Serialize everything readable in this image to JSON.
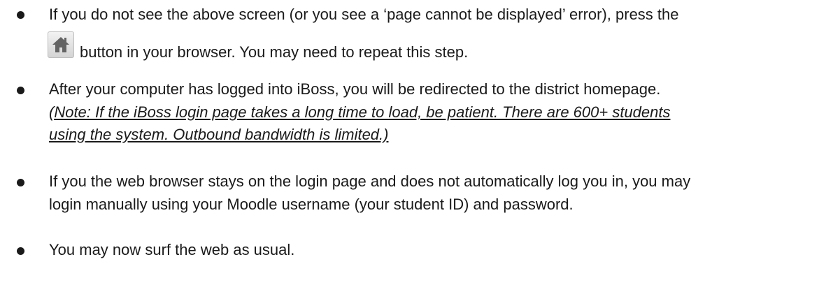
{
  "items": [
    {
      "line1": "If you do not see the above screen (or you see a ‘page cannot be displayed’ error), press the",
      "line2": "button in your browser.  You may need to repeat this step.",
      "icon": "home-icon"
    },
    {
      "line1": "After your computer has logged into iBoss, you will be redirected to the district homepage.",
      "note_line1": "(Note: If the iBoss login page takes a long time to load, be patient.  There are 600+ students",
      "note_line2": "using the system.  Outbound bandwidth is limited.)"
    },
    {
      "line1": "If you the web browser stays on the login page and does not automatically log you in, you may",
      "line2": "login manually using your Moodle username (your student ID) and password."
    },
    {
      "line1": "You may now surf the web as usual."
    }
  ]
}
